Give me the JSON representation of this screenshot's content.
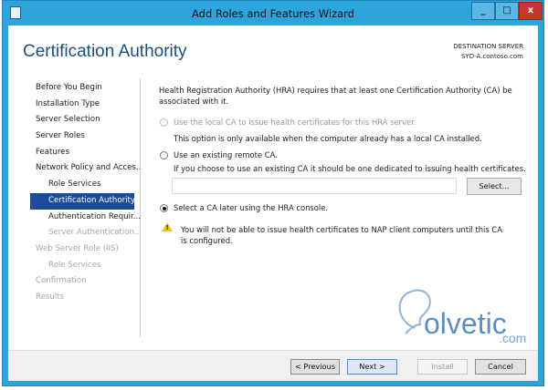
{
  "window": {
    "title": "Add Roles and Features Wizard",
    "minimize": "_",
    "maximize": "□",
    "close": "x"
  },
  "header": {
    "page_title": "Certification Authority",
    "destination_label": "DESTINATION SERVER",
    "destination_server": "SYD-A.contoso.com"
  },
  "nav": {
    "items": [
      {
        "label": "Before You Begin"
      },
      {
        "label": "Installation Type"
      },
      {
        "label": "Server Selection"
      },
      {
        "label": "Server Roles"
      },
      {
        "label": "Features"
      },
      {
        "label": "Network Policy and Acces..."
      },
      {
        "label": "Role Services"
      },
      {
        "label": "Certification Authority"
      },
      {
        "label": "Authentication Requir..."
      },
      {
        "label": "Server Authentication..."
      },
      {
        "label": "Web Server Role (IIS)"
      },
      {
        "label": "Role Services"
      },
      {
        "label": "Confirmation"
      },
      {
        "label": "Results"
      }
    ]
  },
  "content": {
    "intro_line1": "Health Registration Authority (HRA) requires that at least one Certification Authority (CA) be",
    "intro_line2": "associated with it.",
    "option_local": "Use the local CA to issue health certificates for this HRA server.",
    "option_local_note": "This option is only available when the computer already has a local CA installed.",
    "option_remote": "Use an existing remote CA.",
    "option_remote_note": "If you choose to use an existing CA it should be one dedicated to issuing health certificates.",
    "remote_ca_value": "",
    "select_button": "Select...",
    "option_later": "Select a CA later using the HRA console.",
    "selected_option": "later",
    "warning_line1": "You will not be able to issue health certificates to NAP client computers until this CA",
    "warning_line2": "is configured."
  },
  "footer": {
    "previous": "< Previous",
    "next": "Next >",
    "install": "Install",
    "cancel": "Cancel"
  },
  "watermark": {
    "text": "olvetic",
    ".com": ".com",
    "domain": ".com"
  }
}
